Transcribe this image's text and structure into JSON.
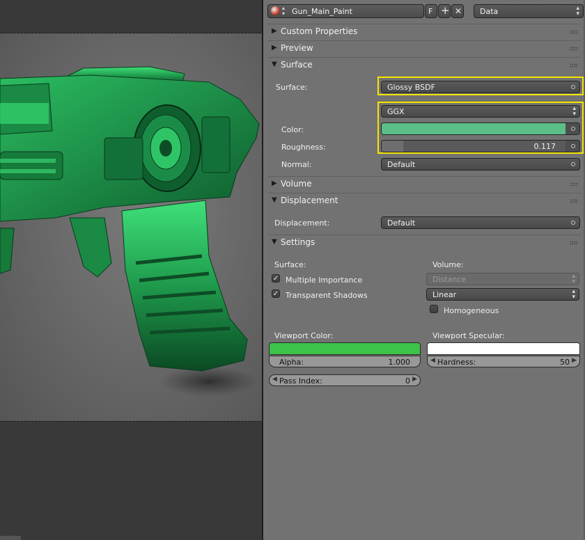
{
  "datablock": {
    "material_name": "Gun_Main_Paint",
    "fake_user": "F",
    "browse_type": "Data"
  },
  "panels": {
    "custom_properties": "Custom Properties",
    "preview": "Preview",
    "surface": "Surface",
    "volume": "Volume",
    "displacement": "Displacement",
    "settings": "Settings"
  },
  "surface": {
    "surface_label": "Surface:",
    "shader": "Glossy BSDF",
    "distribution": "GGX",
    "color_label": "Color:",
    "color_hex": "#5cbf88",
    "roughness_label": "Roughness:",
    "roughness_value": "0.117",
    "roughness_fraction": 0.117,
    "normal_label": "Normal:",
    "normal_value": "Default"
  },
  "displacement": {
    "label": "Displacement:",
    "value": "Default"
  },
  "settings": {
    "surface_heading": "Surface:",
    "volume_heading": "Volume:",
    "multiple_importance": "Multiple Importance",
    "multiple_importance_checked": true,
    "transparent_shadows": "Transparent Shadows",
    "transparent_shadows_checked": true,
    "volume_sampling": "Distance",
    "volume_interpolation": "Linear",
    "homogeneous": "Homogeneous",
    "homogeneous_checked": false,
    "viewport_color_label": "Viewport Color:",
    "viewport_color_hex": "#3dc24a",
    "viewport_specular_label": "Viewport Specular:",
    "viewport_specular_hex": "#ffffff",
    "alpha_label": "Alpha:",
    "alpha_value": "1.000",
    "hardness_label": "Hardness:",
    "hardness_value": "50",
    "pass_index_label": "Pass Index:",
    "pass_index_value": "0"
  },
  "colors": {
    "highlight": "#f5e600",
    "gun_green": "#2ea55a"
  },
  "icons": [
    "material-sphere-icon",
    "browse-arrows-icon",
    "add-icon",
    "close-icon",
    "disclosure-triangle-icon",
    "drag-grip-icon"
  ]
}
